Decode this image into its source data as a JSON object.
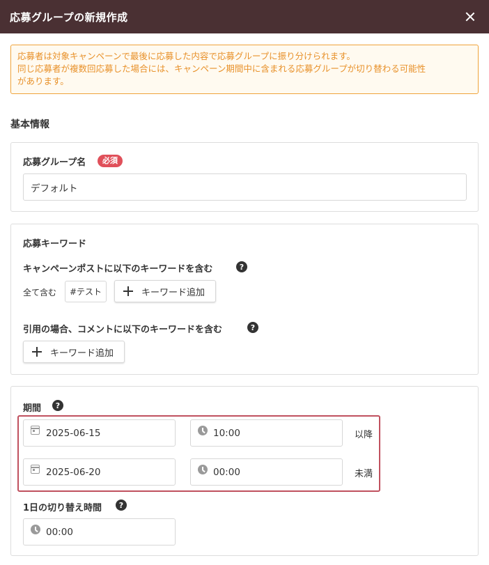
{
  "dialog": {
    "title": "応募グループの新規作成"
  },
  "notice": {
    "line1": "応募者は対象キャンペーンで最後に応募した内容で応募グループに振り分けられます。",
    "line2": "同じ応募者が複数回応募した場合には、キャンペーン期間中に含まれる応募グループが切り替わる可能性",
    "line3": "があります。"
  },
  "basic_info": {
    "section_title": "基本情報",
    "group_name_label": "応募グループ名",
    "required_badge": "必須",
    "group_name_value": "デフォルト"
  },
  "keywords": {
    "title": "応募キーワード",
    "post_label": "キャンペーンポストに以下のキーワードを含む",
    "match_mode": "全て含む",
    "tags": [
      "#テスト"
    ],
    "add_button": "キーワード追加",
    "quote_label": "引用の場合、コメントに以下のキーワードを含む",
    "add_button2": "キーワード追加"
  },
  "period": {
    "label": "期間",
    "start_date": "2025-06-15",
    "start_time": "10:00",
    "start_suffix": "以降",
    "end_date": "2025-06-20",
    "end_time": "00:00",
    "end_suffix": "未満",
    "switch_label": "1日の切り替え時間",
    "switch_time": "00:00"
  },
  "icons": {
    "help": "?"
  },
  "colors": {
    "header_bg": "#4a3033",
    "notice_border": "#f0a33a",
    "notice_text": "#e8912a",
    "required_badge": "#e0505a",
    "highlight_border": "#c0505e"
  }
}
